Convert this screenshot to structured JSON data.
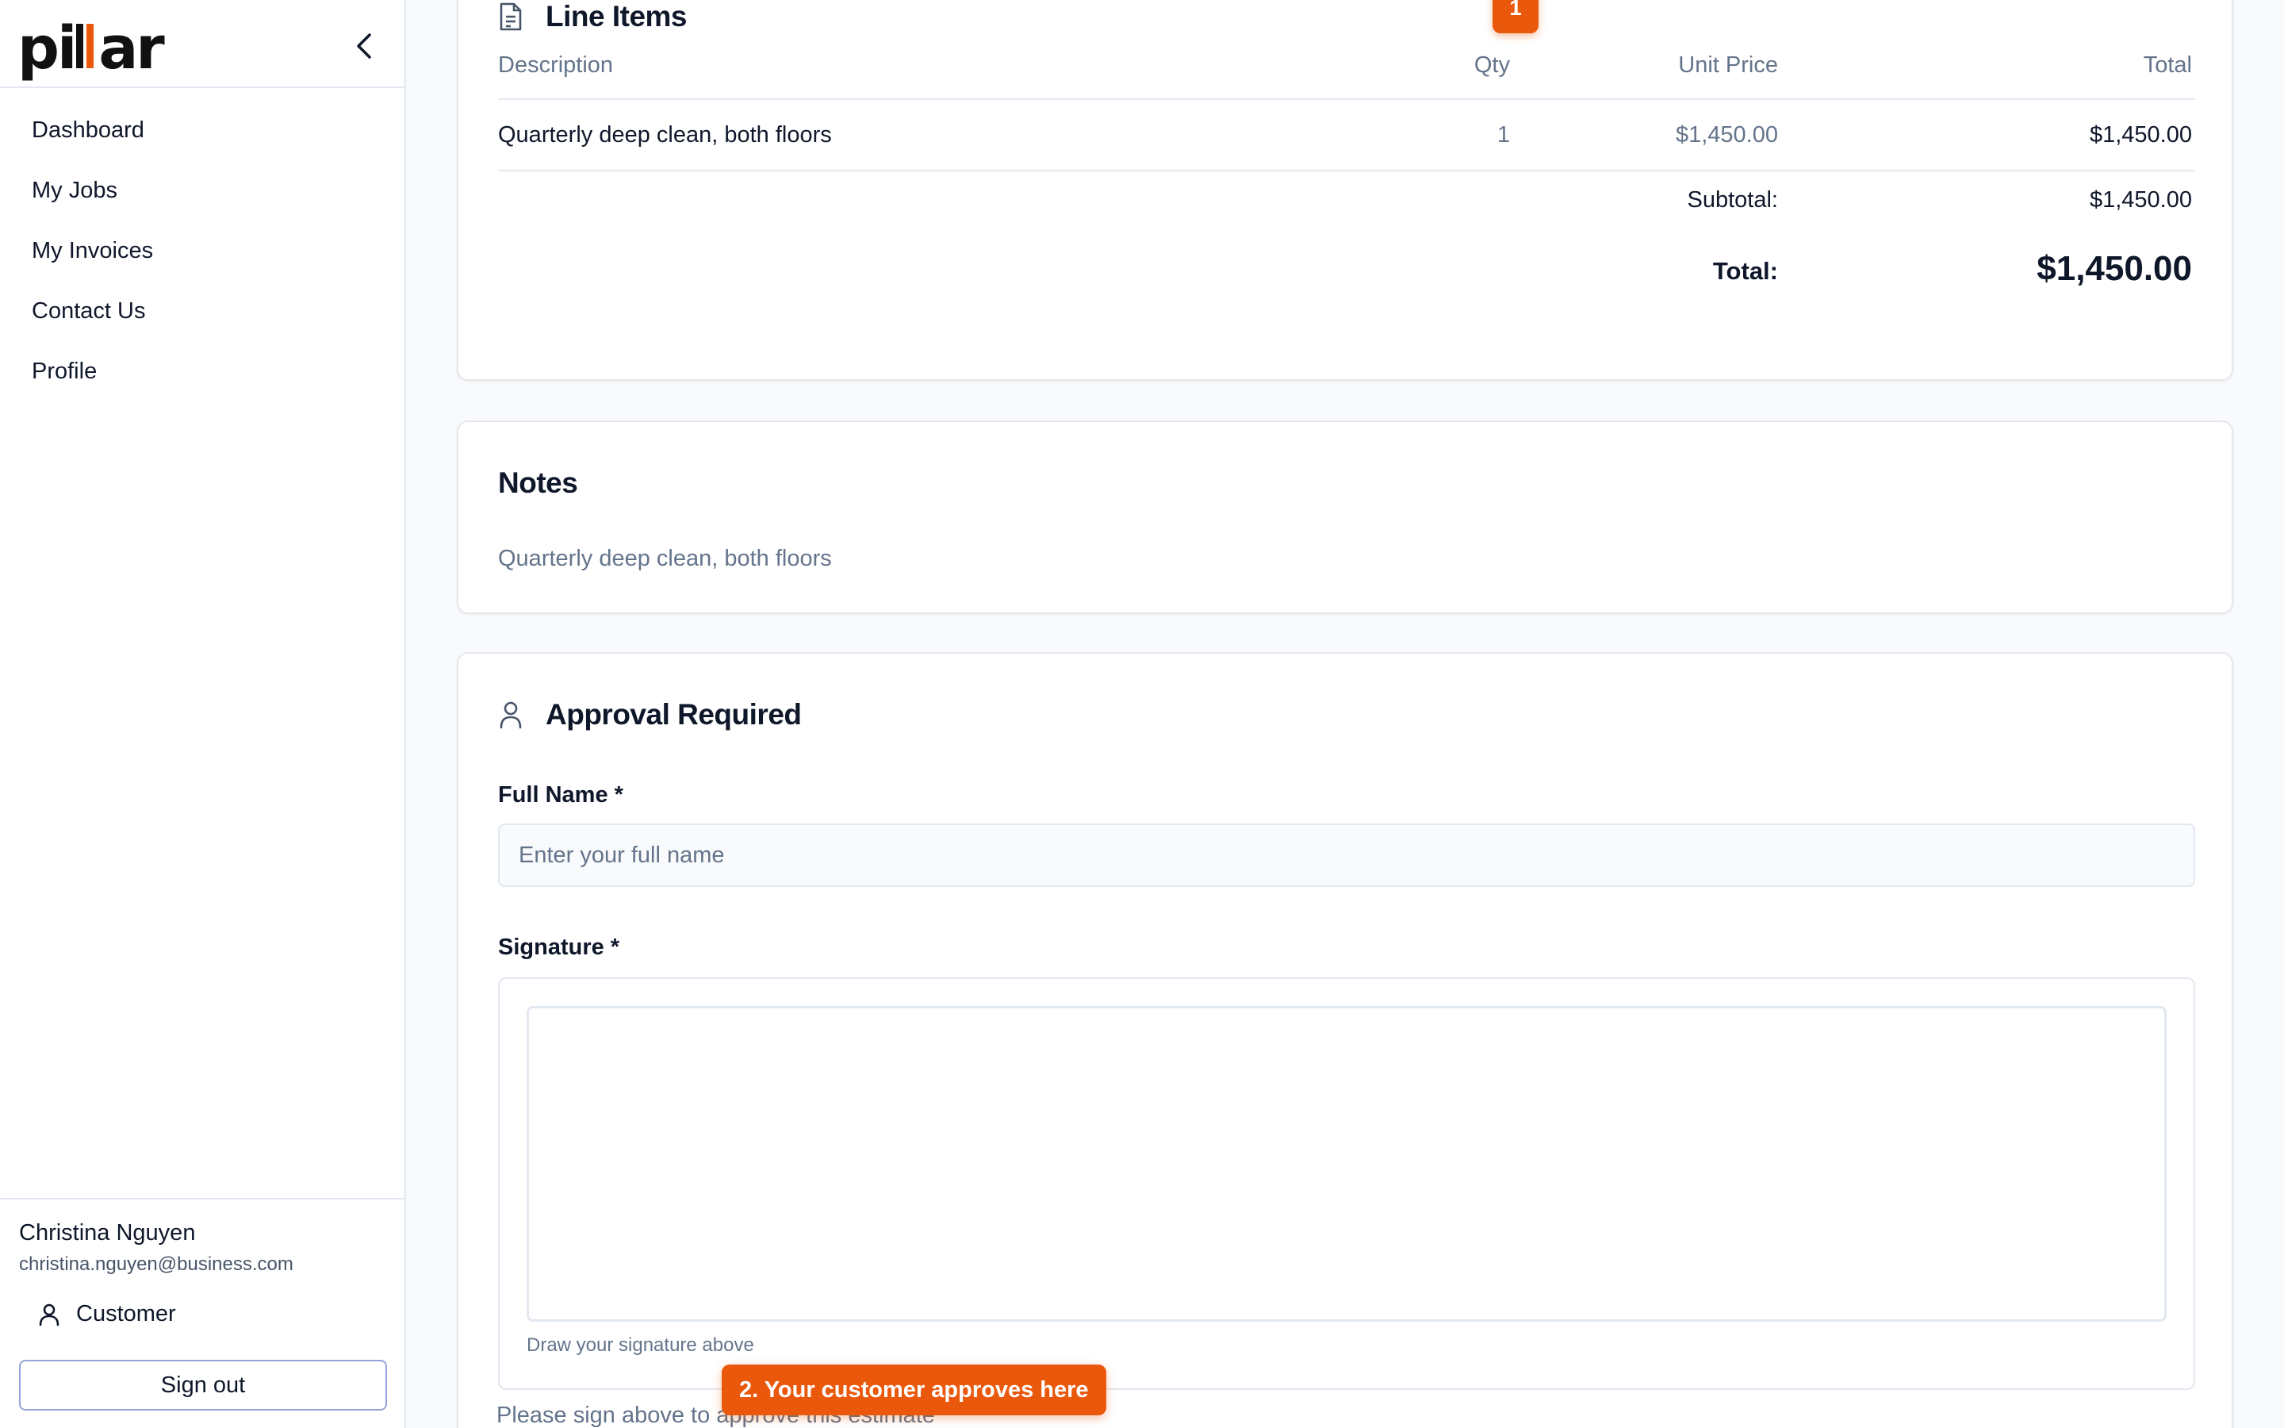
{
  "sidebar": {
    "logo": "pillar",
    "nav": [
      {
        "label": "Dashboard"
      },
      {
        "label": "My Jobs"
      },
      {
        "label": "My Invoices"
      },
      {
        "label": "Contact Us"
      },
      {
        "label": "Profile"
      }
    ],
    "user": {
      "name": "Christina Nguyen",
      "email": "christina.nguyen@business.com",
      "role": "Customer"
    },
    "signout_label": "Sign out"
  },
  "line_items": {
    "title": "Line Items",
    "columns": {
      "description": "Description",
      "qty": "Qty",
      "unit_price": "Unit Price",
      "total": "Total"
    },
    "rows": [
      {
        "description": "Quarterly deep clean, both floors",
        "qty": "1",
        "unit_price": "$1,450.00",
        "total": "$1,450.00"
      }
    ],
    "subtotal_label": "Subtotal:",
    "subtotal": "$1,450.00",
    "total_label": "Total:",
    "total": "$1,450.00"
  },
  "notes": {
    "title": "Notes",
    "text": "Quarterly deep clean, both floors"
  },
  "approval": {
    "title": "Approval Required",
    "full_name_label": "Full Name *",
    "full_name_placeholder": "Enter your full name",
    "full_name_value": "",
    "signature_label": "Signature *",
    "signature_hint": "Draw your signature above",
    "approve_note": "Please sign above to approve this estimate"
  },
  "tour": {
    "step1_badge": "1",
    "step2_callout": "2. Your customer approves here",
    "accent_color": "#ea580c"
  },
  "icons": {
    "collapse": "chevron-left-icon",
    "line_items": "document-icon",
    "approval": "user-icon",
    "role": "user-icon"
  }
}
